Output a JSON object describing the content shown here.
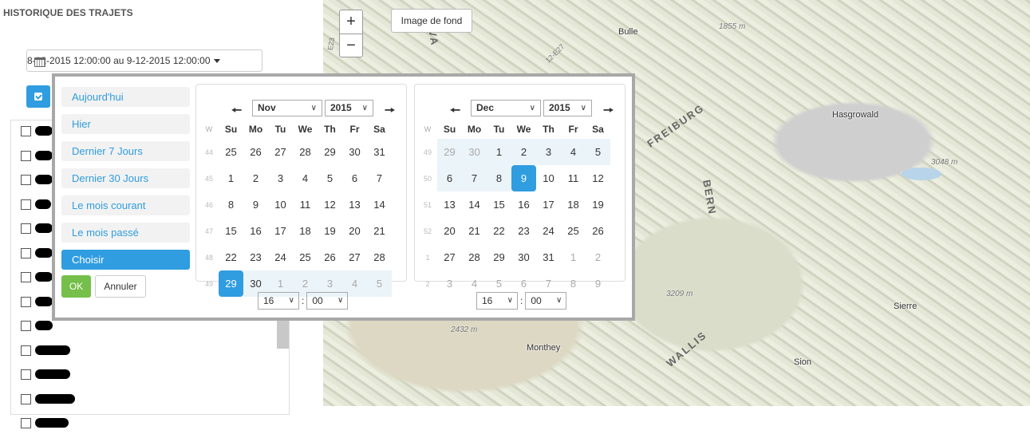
{
  "panel": {
    "title": "HISTORIQUE DES TRAJETS",
    "range_label": "8-12-2015 12:00:00 au 9-12-2015 12:00:00",
    "item_count": 13
  },
  "map": {
    "basemap_button": "Image de fond",
    "zoom_in": "+",
    "zoom_out": "−",
    "towns": [
      "Bulle",
      "Hasgrowald",
      "Monthey",
      "Sierre",
      "Sion"
    ],
    "elevations": [
      "1855 m",
      "3048 m",
      "3209 m",
      "2432 m"
    ],
    "regions": [
      "FREIBURG",
      "BERN",
      "WALLIS",
      "VA"
    ],
    "roads": [
      "E23",
      "12-E27"
    ]
  },
  "picker": {
    "ranges": [
      "Aujourd'hui",
      "Hier",
      "Dernier 7 Jours",
      "Dernier 30 Jours",
      "Le mois courant",
      "Le mois passé",
      "Choisir"
    ],
    "active_range": "Choisir",
    "ok_label": "OK",
    "cancel_label": "Annuler",
    "weekday_header": [
      "W",
      "Su",
      "Mo",
      "Tu",
      "We",
      "Th",
      "Fr",
      "Sa"
    ],
    "left": {
      "month": "Nov",
      "year": "2015",
      "hour": "16",
      "minute": "00",
      "weeks": [
        {
          "wk": "44",
          "days": [
            "25",
            "26",
            "27",
            "28",
            "29",
            "30",
            "31"
          ],
          "off": [],
          "inrange": []
        },
        {
          "wk": "45",
          "days": [
            "1",
            "2",
            "3",
            "4",
            "5",
            "6",
            "7"
          ],
          "off": [],
          "inrange": []
        },
        {
          "wk": "46",
          "days": [
            "8",
            "9",
            "10",
            "11",
            "12",
            "13",
            "14"
          ],
          "off": [],
          "inrange": []
        },
        {
          "wk": "47",
          "days": [
            "15",
            "16",
            "17",
            "18",
            "19",
            "20",
            "21"
          ],
          "off": [],
          "inrange": []
        },
        {
          "wk": "48",
          "days": [
            "22",
            "23",
            "24",
            "25",
            "26",
            "27",
            "28"
          ],
          "off": [],
          "inrange": []
        },
        {
          "wk": "49",
          "days": [
            "29",
            "30",
            "1",
            "2",
            "3",
            "4",
            "5"
          ],
          "off": [
            2,
            3,
            4,
            5,
            6
          ],
          "inrange": [
            1,
            2,
            3,
            4,
            5,
            6
          ],
          "active": 0
        }
      ]
    },
    "right": {
      "month": "Dec",
      "year": "2015",
      "hour": "16",
      "minute": "00",
      "weeks": [
        {
          "wk": "49",
          "days": [
            "29",
            "30",
            "1",
            "2",
            "3",
            "4",
            "5"
          ],
          "off": [
            0,
            1
          ],
          "inrange": [
            0,
            1,
            2,
            3,
            4,
            5,
            6
          ]
        },
        {
          "wk": "50",
          "days": [
            "6",
            "7",
            "8",
            "9",
            "10",
            "11",
            "12"
          ],
          "off": [],
          "inrange": [
            0,
            1,
            2
          ],
          "active": 3
        },
        {
          "wk": "51",
          "days": [
            "13",
            "14",
            "15",
            "16",
            "17",
            "18",
            "19"
          ],
          "off": [],
          "inrange": []
        },
        {
          "wk": "52",
          "days": [
            "20",
            "21",
            "22",
            "23",
            "24",
            "25",
            "26"
          ],
          "off": [],
          "inrange": []
        },
        {
          "wk": "1",
          "days": [
            "27",
            "28",
            "29",
            "30",
            "31",
            "1",
            "2"
          ],
          "off": [
            5,
            6
          ],
          "inrange": []
        },
        {
          "wk": "2",
          "days": [
            "3",
            "4",
            "5",
            "6",
            "7",
            "8",
            "9"
          ],
          "off": [
            0,
            1,
            2,
            3,
            4,
            5,
            6
          ],
          "inrange": []
        }
      ]
    }
  }
}
